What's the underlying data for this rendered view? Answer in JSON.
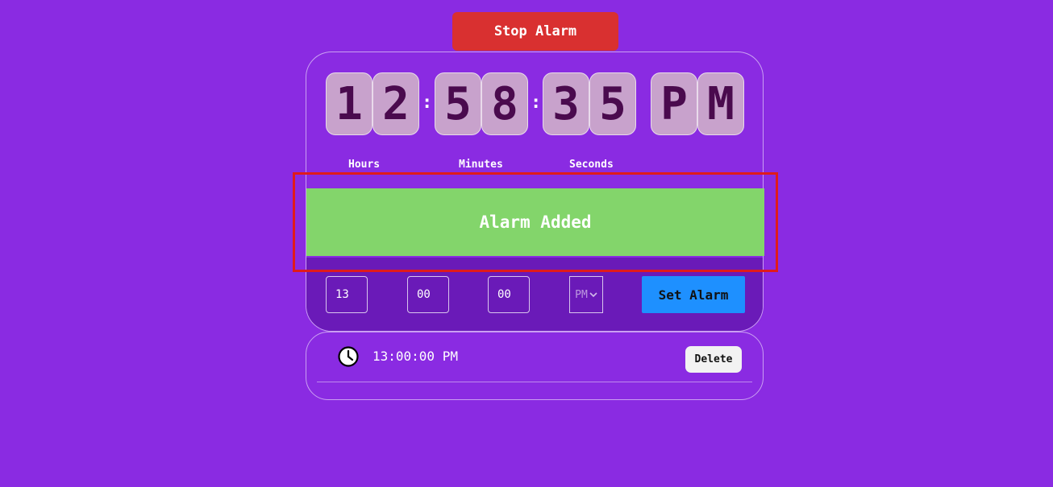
{
  "stop_alarm_label": "Stop Alarm",
  "clock": {
    "hour_digits": [
      "1",
      "2"
    ],
    "minute_digits": [
      "5",
      "8"
    ],
    "second_digits": [
      "3",
      "5"
    ],
    "meridiem_letters": [
      "P",
      "M"
    ],
    "separator": ":",
    "labels": {
      "hours": "Hours",
      "minutes": "Minutes",
      "seconds": "Seconds"
    }
  },
  "toast_message": "Alarm Added",
  "alarm_form": {
    "hour_value": "13",
    "minute_value": "00",
    "second_value": "00",
    "meridiem_value": "PM",
    "set_label": "Set Alarm"
  },
  "alarms": [
    {
      "time": "13:00:00 PM",
      "delete_label": "Delete",
      "icon": "clock-icon"
    }
  ],
  "colors": {
    "background": "#8a2be2",
    "stop_button": "#d93030",
    "toast": "#83d56b",
    "set_button": "#1e90ff",
    "digit_tile": "#c8a2cc",
    "highlight": "#e01b1b"
  }
}
